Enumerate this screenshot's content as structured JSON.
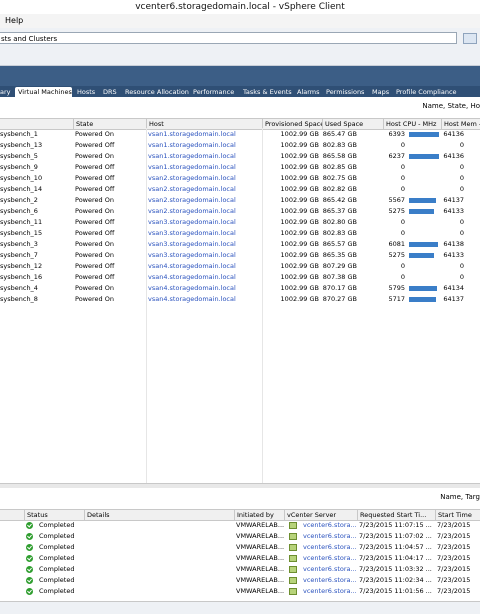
{
  "window": {
    "title": "vcenter6.storagedomain.local - vSphere Client"
  },
  "menu": {
    "help": "Help"
  },
  "address": {
    "text": "sts and Clusters"
  },
  "tabs": [
    {
      "label": "ary"
    },
    {
      "label": "Virtual Machines"
    },
    {
      "label": "Hosts"
    },
    {
      "label": "DRS"
    },
    {
      "label": "Resource Allocation"
    },
    {
      "label": "Performance"
    },
    {
      "label": "Tasks & Events"
    },
    {
      "label": "Alarms"
    },
    {
      "label": "Permissions"
    },
    {
      "label": "Maps"
    },
    {
      "label": "Profile Compliance"
    }
  ],
  "vm_grid": {
    "filter_hint": "Name, State, Ho",
    "headers": {
      "name": "",
      "state": "State",
      "host": "Host",
      "provisioned": "Provisioned Space",
      "used": "Used Space",
      "cpu": "Host CPU - MHz",
      "mem": "Host Mem -"
    },
    "rows": [
      {
        "name": "sysbench_1",
        "state": "Powered On",
        "host": "vsan1.storagedomain.local",
        "prov": "1002.99 GB",
        "used": "865.47 GB",
        "cpu": "6393",
        "cpu_frac": 0.95,
        "mem": "64136"
      },
      {
        "name": "sysbench_13",
        "state": "Powered Off",
        "host": "vsan1.storagedomain.local",
        "prov": "1002.99 GB",
        "used": "802.83 GB",
        "cpu": "0",
        "cpu_frac": 0,
        "mem": "0"
      },
      {
        "name": "sysbench_5",
        "state": "Powered On",
        "host": "vsan1.storagedomain.local",
        "prov": "1002.99 GB",
        "used": "865.58 GB",
        "cpu": "6237",
        "cpu_frac": 0.93,
        "mem": "64136"
      },
      {
        "name": "sysbench_9",
        "state": "Powered Off",
        "host": "vsan1.storagedomain.local",
        "prov": "1002.99 GB",
        "used": "802.85 GB",
        "cpu": "0",
        "cpu_frac": 0,
        "mem": "0"
      },
      {
        "name": "sysbench_10",
        "state": "Powered Off",
        "host": "vsan2.storagedomain.local",
        "prov": "1002.99 GB",
        "used": "802.75 GB",
        "cpu": "0",
        "cpu_frac": 0,
        "mem": "0"
      },
      {
        "name": "sysbench_14",
        "state": "Powered Off",
        "host": "vsan2.storagedomain.local",
        "prov": "1002.99 GB",
        "used": "802.82 GB",
        "cpu": "0",
        "cpu_frac": 0,
        "mem": "0"
      },
      {
        "name": "sysbench_2",
        "state": "Powered On",
        "host": "vsan2.storagedomain.local",
        "prov": "1002.99 GB",
        "used": "865.42 GB",
        "cpu": "5567",
        "cpu_frac": 0.83,
        "mem": "64137"
      },
      {
        "name": "sysbench_6",
        "state": "Powered On",
        "host": "vsan2.storagedomain.local",
        "prov": "1002.99 GB",
        "used": "865.37 GB",
        "cpu": "5275",
        "cpu_frac": 0.79,
        "mem": "64133"
      },
      {
        "name": "sysbench_11",
        "state": "Powered Off",
        "host": "vsan3.storagedomain.local",
        "prov": "1002.99 GB",
        "used": "802.80 GB",
        "cpu": "0",
        "cpu_frac": 0,
        "mem": "0"
      },
      {
        "name": "sysbench_15",
        "state": "Powered Off",
        "host": "vsan3.storagedomain.local",
        "prov": "1002.99 GB",
        "used": "802.83 GB",
        "cpu": "0",
        "cpu_frac": 0,
        "mem": "0"
      },
      {
        "name": "sysbench_3",
        "state": "Powered On",
        "host": "vsan3.storagedomain.local",
        "prov": "1002.99 GB",
        "used": "865.57 GB",
        "cpu": "6081",
        "cpu_frac": 0.9,
        "mem": "64138"
      },
      {
        "name": "sysbench_7",
        "state": "Powered On",
        "host": "vsan3.storagedomain.local",
        "prov": "1002.99 GB",
        "used": "865.35 GB",
        "cpu": "5275",
        "cpu_frac": 0.79,
        "mem": "64133"
      },
      {
        "name": "sysbench_12",
        "state": "Powered Off",
        "host": "vsan4.storagedomain.local",
        "prov": "1002.99 GB",
        "used": "807.29 GB",
        "cpu": "0",
        "cpu_frac": 0,
        "mem": "0"
      },
      {
        "name": "sysbench_16",
        "state": "Powered Off",
        "host": "vsan4.storagedomain.local",
        "prov": "1002.99 GB",
        "used": "807.38 GB",
        "cpu": "0",
        "cpu_frac": 0,
        "mem": "0"
      },
      {
        "name": "sysbench_4",
        "state": "Powered On",
        "host": "vsan4.storagedomain.local",
        "prov": "1002.99 GB",
        "used": "870.17 GB",
        "cpu": "5795",
        "cpu_frac": 0.86,
        "mem": "64134"
      },
      {
        "name": "sysbench_8",
        "state": "Powered On",
        "host": "vsan4.storagedomain.local",
        "prov": "1002.99 GB",
        "used": "870.27 GB",
        "cpu": "5717",
        "cpu_frac": 0.85,
        "mem": "64137"
      }
    ]
  },
  "recent_tasks": {
    "filter_hint": "Name, Targ",
    "headers": {
      "status": "Status",
      "details": "Details",
      "initiated": "Initiated by",
      "vcenter": "vCenter Server",
      "req_start": "Requested Start Ti...",
      "start": "Start Time"
    },
    "rows": [
      {
        "status": "Completed",
        "initiated": "VMWARELAB...",
        "vcenter": "vcenter6.stora...",
        "req_start": "7/23/2015 11:07:15 ...",
        "start": "7/23/2015"
      },
      {
        "status": "Completed",
        "initiated": "VMWARELAB...",
        "vcenter": "vcenter6.stora...",
        "req_start": "7/23/2015 11:07:02 ...",
        "start": "7/23/2015"
      },
      {
        "status": "Completed",
        "initiated": "VMWARELAB...",
        "vcenter": "vcenter6.stora...",
        "req_start": "7/23/2015 11:04:57 ...",
        "start": "7/23/2015"
      },
      {
        "status": "Completed",
        "initiated": "VMWARELAB...",
        "vcenter": "vcenter6.stora...",
        "req_start": "7/23/2015 11:04:17 ...",
        "start": "7/23/2015"
      },
      {
        "status": "Completed",
        "initiated": "VMWARELAB...",
        "vcenter": "vcenter6.stora...",
        "req_start": "7/23/2015 11:03:32 ...",
        "start": "7/23/2015"
      },
      {
        "status": "Completed",
        "initiated": "VMWARELAB...",
        "vcenter": "vcenter6.stora...",
        "req_start": "7/23/2015 11:02:34 ...",
        "start": "7/23/2015"
      },
      {
        "status": "Completed",
        "initiated": "VMWARELAB...",
        "vcenter": "vcenter6.stora...",
        "req_start": "7/23/2015 11:01:56 ...",
        "start": "7/23/2015"
      }
    ]
  },
  "colors": {
    "accent": "#3c5e86",
    "bar": "#3a7ec8",
    "link": "#2a52be",
    "ok": "#2f9e2f"
  }
}
